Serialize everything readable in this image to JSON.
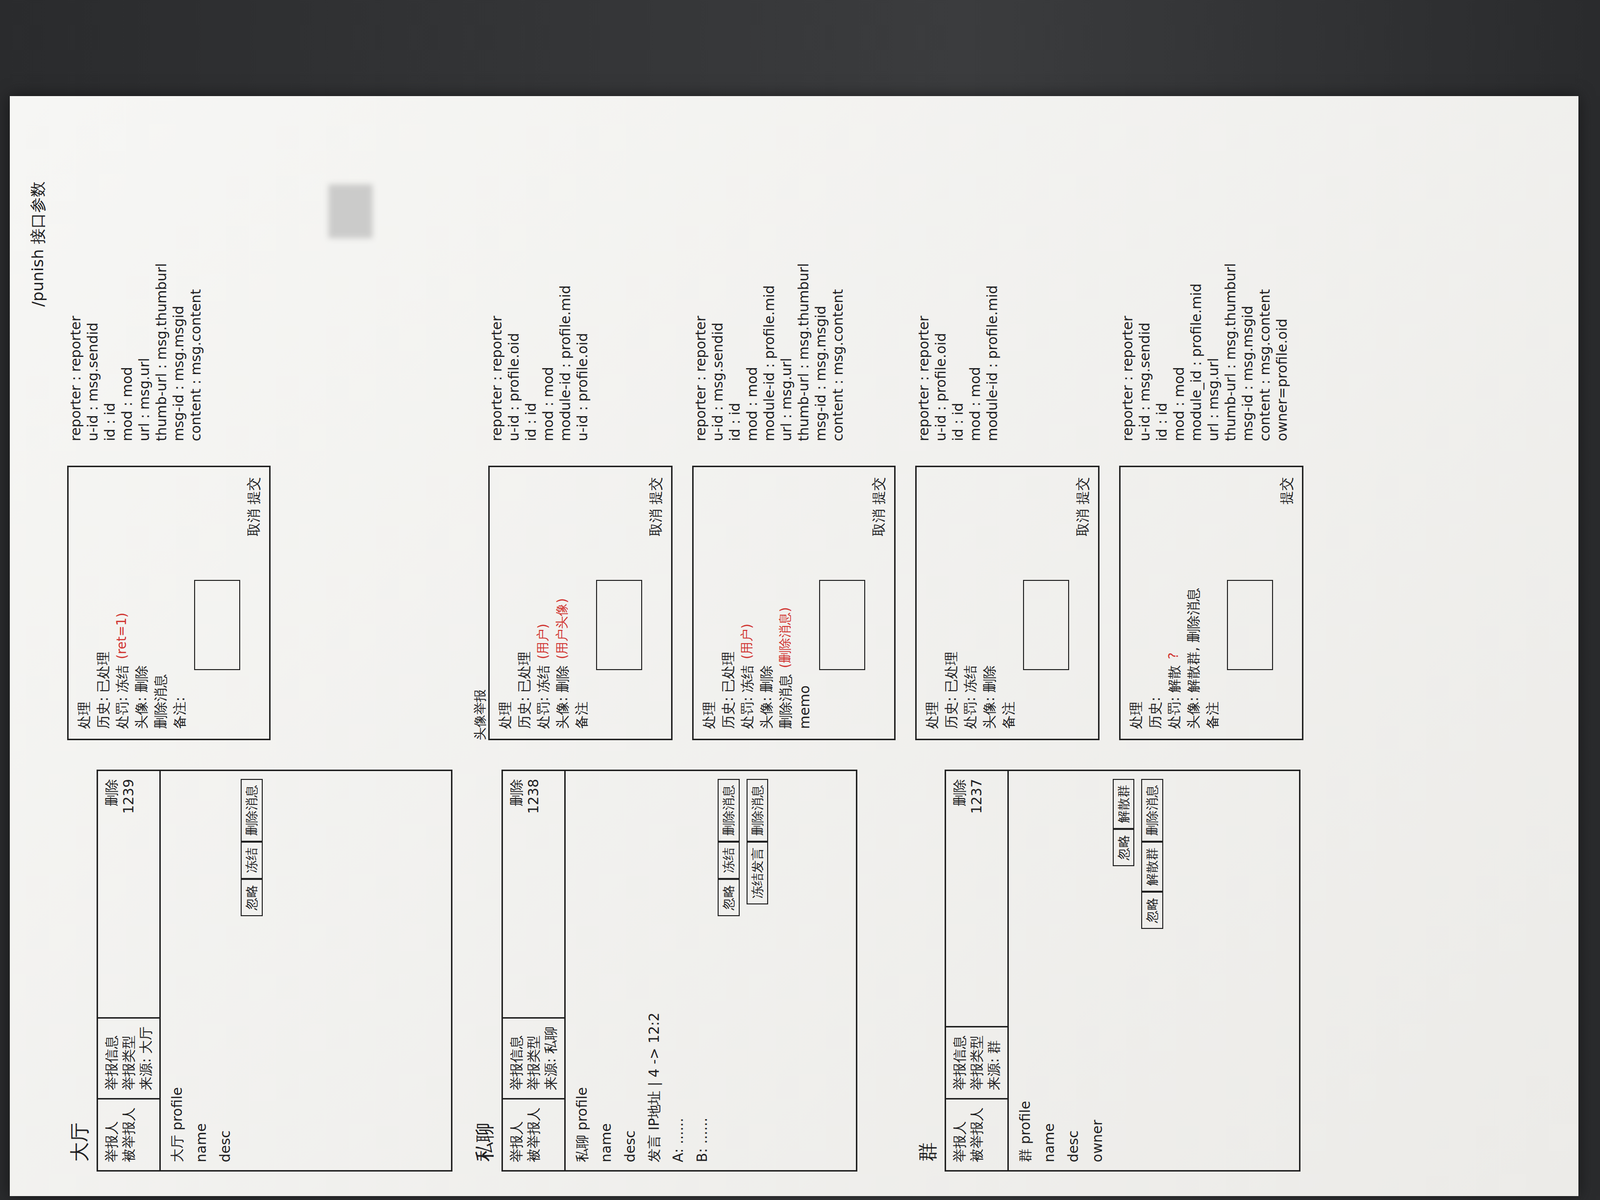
{
  "title": "/punish 接口参数",
  "sections": [
    {
      "name": "大厅",
      "panel": {
        "reporters": [
          "举报人",
          "被举报人"
        ],
        "info": [
          "举报信息",
          "举报类型",
          "来源: 大厅"
        ],
        "action": "删除",
        "count": "1239",
        "profile": "大厅 profile",
        "fields": [
          "name",
          "desc"
        ],
        "buttons": [
          [
            "忽略",
            "冻结",
            "删除消息"
          ]
        ],
        "chat": []
      },
      "forms": [
        {
          "label": "",
          "lines": [
            {
              "text": "处理"
            },
            {
              "text": "历史: 已处理"
            },
            {
              "text": "处罚: 冻结",
              "note": "(ret=1)",
              "color": "#d0312d"
            },
            {
              "text": "头像: 删除"
            },
            {
              "text": "删除消息"
            },
            {
              "text": "备注:"
            }
          ],
          "submit": "取消 提交",
          "mapping": [
            "reporter : reporter",
            "u-id : msg.sendid",
            "id : id",
            "mod : mod",
            "url : msg.url",
            "thumb-url : msg.thumburl",
            "msg-id : msg.msgid",
            "content : msg.content"
          ]
        }
      ]
    },
    {
      "name": "私聊",
      "panel": {
        "reporters": [
          "举报人",
          "被举报人"
        ],
        "info": [
          "举报信息",
          "举报类型",
          "来源: 私聊"
        ],
        "action": "删除",
        "count": "1238",
        "profile": "私聊 profile",
        "fields": [
          "name",
          "desc"
        ],
        "buttons": [
          [
            "忽略",
            "冻结",
            "删除消息"
          ],
          [
            "冻结发言",
            "删除消息"
          ]
        ],
        "chat": [
          "发言 IP地址 | 4 -> 12:2",
          "A: ......",
          "B: ......"
        ]
      },
      "forms": [
        {
          "label": "头像举报",
          "lines": [
            {
              "text": "处理"
            },
            {
              "text": "历史: 已处理"
            },
            {
              "text": "处罚: 冻结",
              "note": "(用户)",
              "color": "#d0312d"
            },
            {
              "text": "头像: 删除",
              "note": "(用户头像)",
              "color": "#d0312d"
            },
            {
              "text": "备注"
            }
          ],
          "submit": "取消 提交",
          "mapping": [
            "reporter : reporter",
            "u-id : profile.oid",
            "id : id",
            "mod : mod",
            "module-id : profile.mid",
            "u-id : profile.oid"
          ]
        },
        {
          "label": "",
          "lines": [
            {
              "text": "处理"
            },
            {
              "text": "历史: 已处理"
            },
            {
              "text": "处罚: 冻结",
              "note": "(用户)",
              "color": "#d0312d"
            },
            {
              "text": "头像: 删除"
            },
            {
              "text": "删除消息",
              "note": "(删除消息)",
              "color": "#d0312d"
            },
            {
              "text": "memo"
            }
          ],
          "submit": "取消 提交",
          "mapping": [
            "reporter : reporter",
            "u-id : msg.sendid",
            "id : id",
            "mod : mod",
            "module-id : profile.mid",
            "url : msg.url",
            "thumb-url : msg.thumburl",
            "msg-id : msg.msgid",
            "content : msg.content"
          ]
        }
      ]
    },
    {
      "name": "群",
      "panel": {
        "reporters": [
          "举报人",
          "被举报人"
        ],
        "info": [
          "举报信息",
          "举报类型",
          "来源: 群"
        ],
        "action": "删除",
        "count": "1237",
        "profile": "群 profile",
        "fields": [
          "name",
          "desc",
          "owner"
        ],
        "buttons": [
          [
            "忽略",
            "解散群"
          ],
          [
            "忽略",
            "解散群",
            "删除消息"
          ]
        ],
        "chat": []
      },
      "forms": [
        {
          "label": "",
          "lines": [
            {
              "text": "处理"
            },
            {
              "text": "历史: 已处理"
            },
            {
              "text": "处罚: 冻结"
            },
            {
              "text": "头像: 删除"
            },
            {
              "text": "备注"
            }
          ],
          "submit": "取消 提交",
          "mapping": [
            "reporter : reporter",
            "u-id : profile.oid",
            "id : id",
            "mod : mod",
            "module-id : profile.mid"
          ]
        },
        {
          "label": "",
          "lines": [
            {
              "text": "处理"
            },
            {
              "text": "历史:"
            },
            {
              "text": "处罚: 解散",
              "note": "?",
              "color": "#d0312d"
            },
            {
              "text": "头像: 解散群, 删除消息"
            },
            {
              "text": "备注"
            }
          ],
          "submit": "提交",
          "mapping": [
            "reporter : reporter",
            "u-id : msg.sendid",
            "id : id",
            "mod : mod",
            "module_id : profile.mid",
            "url : msg.url",
            "thumb-url : msg.thumburl",
            "msg-id : msg.msgid",
            "content : msg.content",
            "owner=profile.oid"
          ]
        }
      ]
    }
  ]
}
